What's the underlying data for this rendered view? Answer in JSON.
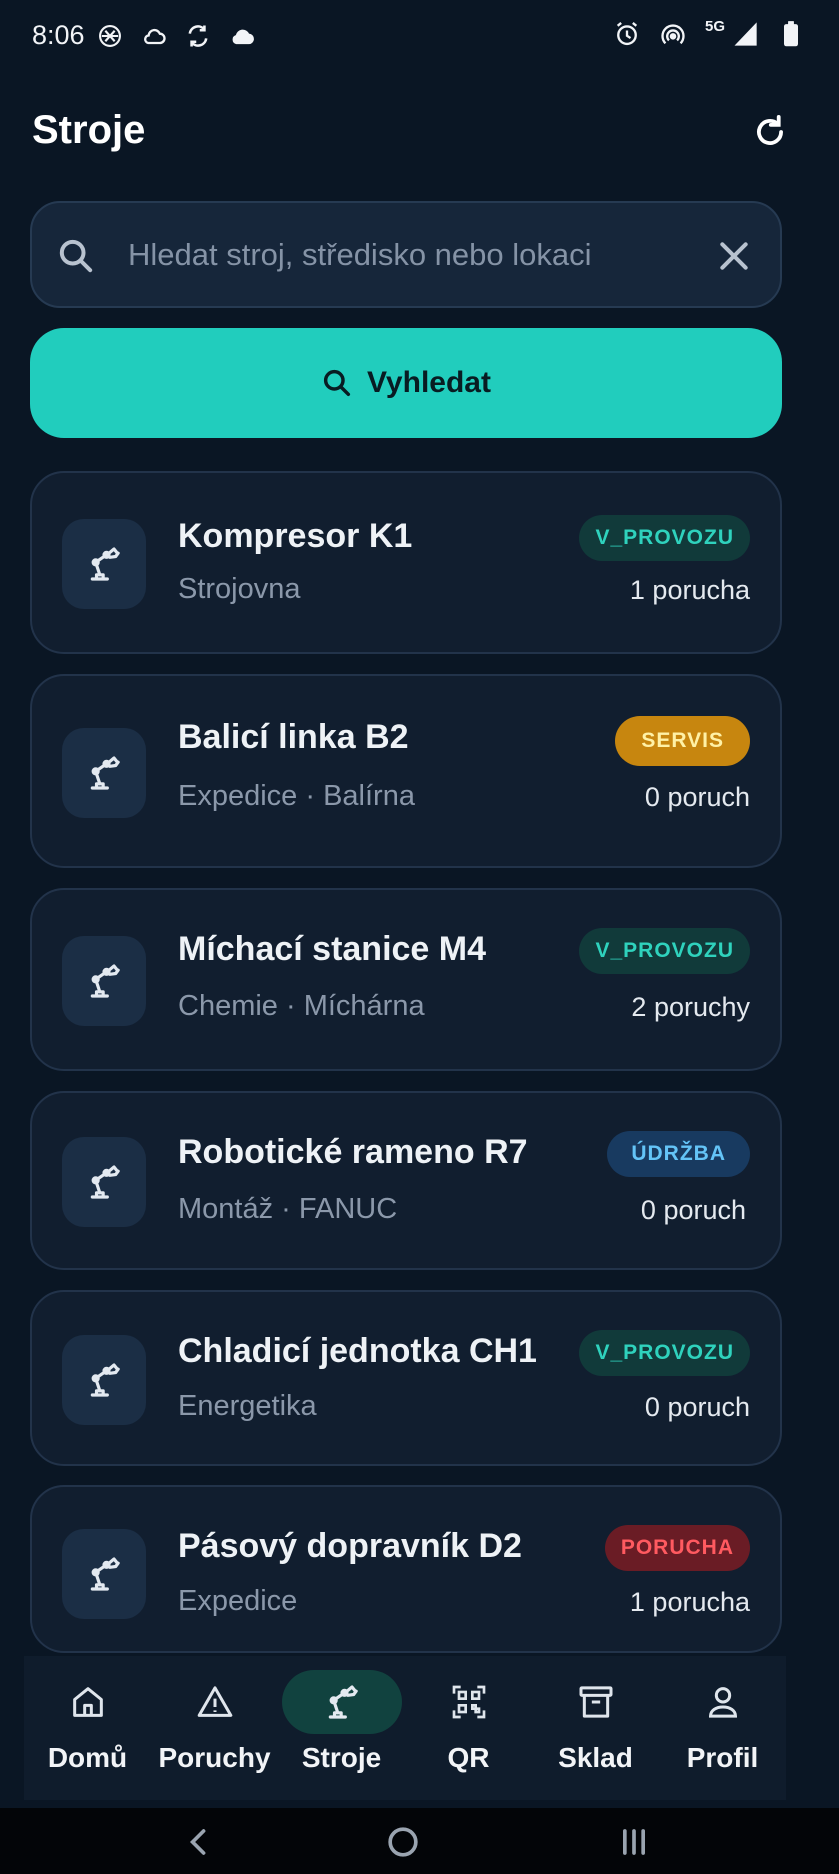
{
  "status_bar": {
    "time": "8:06",
    "network": "5G",
    "left_icons": [
      "chatgpt-icon",
      "cloud-outline-icon",
      "sync-icon",
      "cloud-icon"
    ],
    "right_icons": [
      "alarm-icon",
      "hotspot-icon",
      "signal-icon",
      "battery-icon"
    ]
  },
  "header": {
    "title": "Stroje"
  },
  "search": {
    "placeholder": "Hledat stroj, středisko nebo lokaci",
    "value": "",
    "button_label": "Vyhledat"
  },
  "machines": [
    {
      "name": "Kompresor K1",
      "location": "Strojovna",
      "status": "V_PROVOZU",
      "faults": "1 porucha"
    },
    {
      "name": "Balicí linka B2",
      "location": "Expedice · Balírna",
      "status": "SERVIS",
      "faults": "0 poruch"
    },
    {
      "name": "Míchací stanice M4",
      "location": "Chemie · Míchárna",
      "status": "V_PROVOZU",
      "faults": "2 poruchy"
    },
    {
      "name": "Robotické rameno R7",
      "location": "Montáž · FANUC",
      "status": "ÚDRŽBA",
      "faults": "0 poruch"
    },
    {
      "name": "Chladicí jednotka CH1",
      "location": "Energetika",
      "status": "V_PROVOZU",
      "faults": "0 poruch"
    },
    {
      "name": "Pásový dopravník D2",
      "location": "Expedice",
      "status": "PORUCHA",
      "faults": "1 porucha"
    }
  ],
  "bottom_nav": {
    "active": "Stroje",
    "items": [
      {
        "label": "Domů",
        "icon": "home-icon"
      },
      {
        "label": "Poruchy",
        "icon": "warning-icon"
      },
      {
        "label": "Stroje",
        "icon": "robot-arm-icon"
      },
      {
        "label": "QR",
        "icon": "qr-icon"
      },
      {
        "label": "Sklad",
        "icon": "archive-icon"
      },
      {
        "label": "Profil",
        "icon": "person-icon"
      }
    ]
  },
  "colors": {
    "accent": "#21cdbd",
    "background": "#0a1624",
    "card": "#111e2f",
    "status_running": "#2fd2bd",
    "status_service": "#c7860f",
    "status_maintenance": "#64c4f7",
    "status_fault": "#ff5a60"
  }
}
